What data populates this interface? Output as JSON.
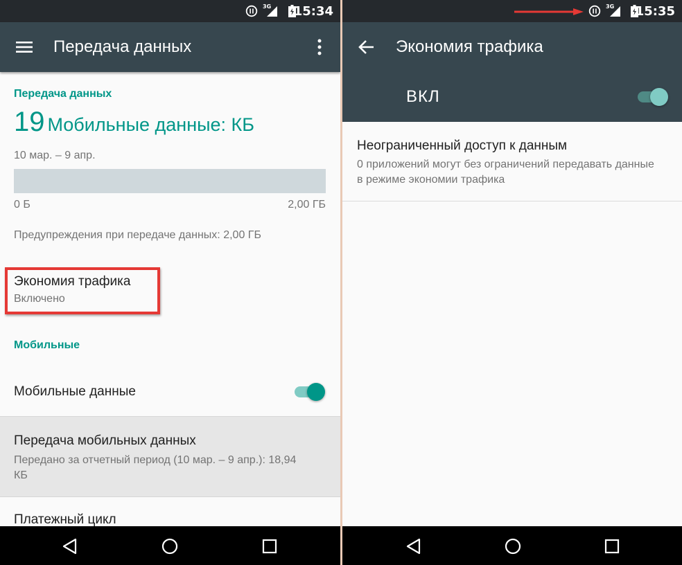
{
  "left": {
    "status_time": "15:34",
    "title": "Передача данных",
    "section_usage": "Передача данных",
    "usage_number": "19",
    "usage_unit": "Мобильные данные: КБ",
    "period": "10 мар. – 9 апр.",
    "bar_min": "0 Б",
    "bar_max": "2,00 ГБ",
    "usage_fraction": 0.0,
    "warning": "Предупреждения при передаче данных: 2,00 ГБ",
    "saver_title": "Экономия трафика",
    "saver_sub": "Включено",
    "section_mobile": "Мобильные",
    "mobile_data_label": "Мобильные данные",
    "mobile_data_on": true,
    "mobile_usage_title": "Передача мобильных данных",
    "mobile_usage_sub": "Передано за отчетный период (10 мар. – 9 апр.): 18,94 КБ",
    "billing_cycle": "Платежный цикл"
  },
  "right": {
    "status_time": "15:35",
    "title": "Экономия трафика",
    "toggle_label": "ВКЛ",
    "toggle_on": true,
    "unrestricted_title": "Неограниченный доступ к данным",
    "unrestricted_sub": "0 приложений могут без ограничений передавать данные в режиме экономии трафика"
  },
  "status": {
    "network_label": "3G"
  },
  "colors": {
    "appbar": "#37474f",
    "statusbar": "#25292d",
    "accent": "#009688",
    "accent_light": "#80cbc4",
    "highlight": "#e53935"
  },
  "icons": {
    "menu": "menu-icon",
    "overflow": "more-vert-icon",
    "back": "arrow-back-icon",
    "saver": "data-saver-icon",
    "signal": "signal-3g-icon",
    "battery": "battery-icon",
    "nav_back": "nav-back-icon",
    "nav_home": "nav-home-icon",
    "nav_recents": "nav-recents-icon"
  }
}
